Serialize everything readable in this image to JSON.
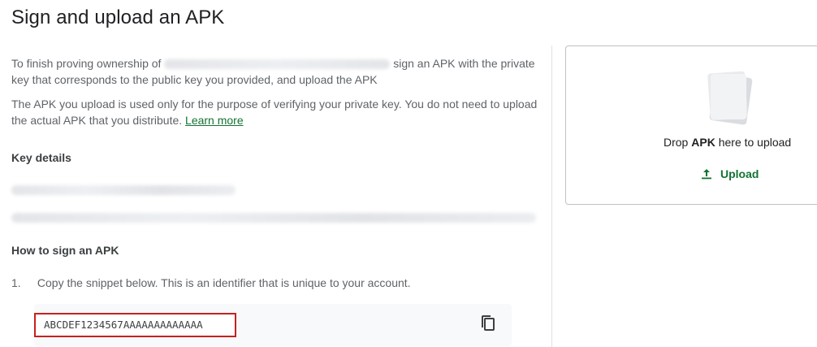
{
  "page": {
    "title": "Sign and upload an APK"
  },
  "intro": {
    "part1": "To finish proving ownership of",
    "part2": "sign an APK with the private key that corresponds to the public key you provided, and upload the APK"
  },
  "note": {
    "text": "The APK you upload is used only for the purpose of verifying your private key. You do not need to upload the actual APK that you distribute.",
    "link_label": "Learn more"
  },
  "key_details": {
    "heading": "Key details"
  },
  "how_to": {
    "heading": "How to sign an APK",
    "steps": [
      {
        "number": "1.",
        "text": "Copy the snippet below. This is an identifier that is unique to your account."
      }
    ],
    "snippet": "ABCDEF1234567AAAAAAAAAAAAA"
  },
  "upload": {
    "drop_prefix": "Drop",
    "drop_bold": "APK",
    "drop_suffix": "here to upload",
    "button_label": "Upload"
  },
  "colors": {
    "accent": "#137333",
    "highlight_border": "#c5221f",
    "snippet_bg": "#f8f9fa"
  },
  "icons": {
    "copy": "copy-icon",
    "upload": "upload-icon",
    "file": "file-stack-icon"
  }
}
